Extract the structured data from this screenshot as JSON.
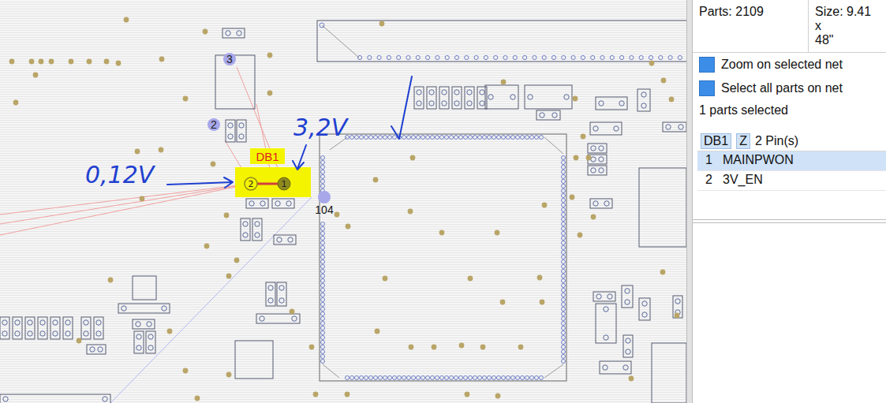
{
  "canvas": {
    "net_markers": [
      {
        "label": "3"
      },
      {
        "label": "2"
      },
      {
        "label": "104"
      }
    ],
    "part": {
      "label": "DB1",
      "pins": [
        {
          "number": "1",
          "selected": true
        },
        {
          "number": "2",
          "selected": false
        }
      ]
    },
    "annotations": [
      {
        "text": "0,12V"
      },
      {
        "text": "3,2V"
      }
    ]
  },
  "panel": {
    "parts": "Parts: 2109",
    "size": [
      "Size: 9.41 x",
      "48\""
    ],
    "options": [
      {
        "label": "Zoom on selected net",
        "checked": true
      },
      {
        "label": "Select all parts on net",
        "checked": true
      }
    ],
    "selection_count": "1 parts selected",
    "part": {
      "name": "DB1",
      "side": "Z",
      "pin_count": "2 Pin(s)"
    },
    "pins": [
      {
        "number": "1",
        "net": "MAINPWON",
        "selected": true
      },
      {
        "number": "2",
        "net": "3V_EN",
        "selected": false
      }
    ]
  }
}
